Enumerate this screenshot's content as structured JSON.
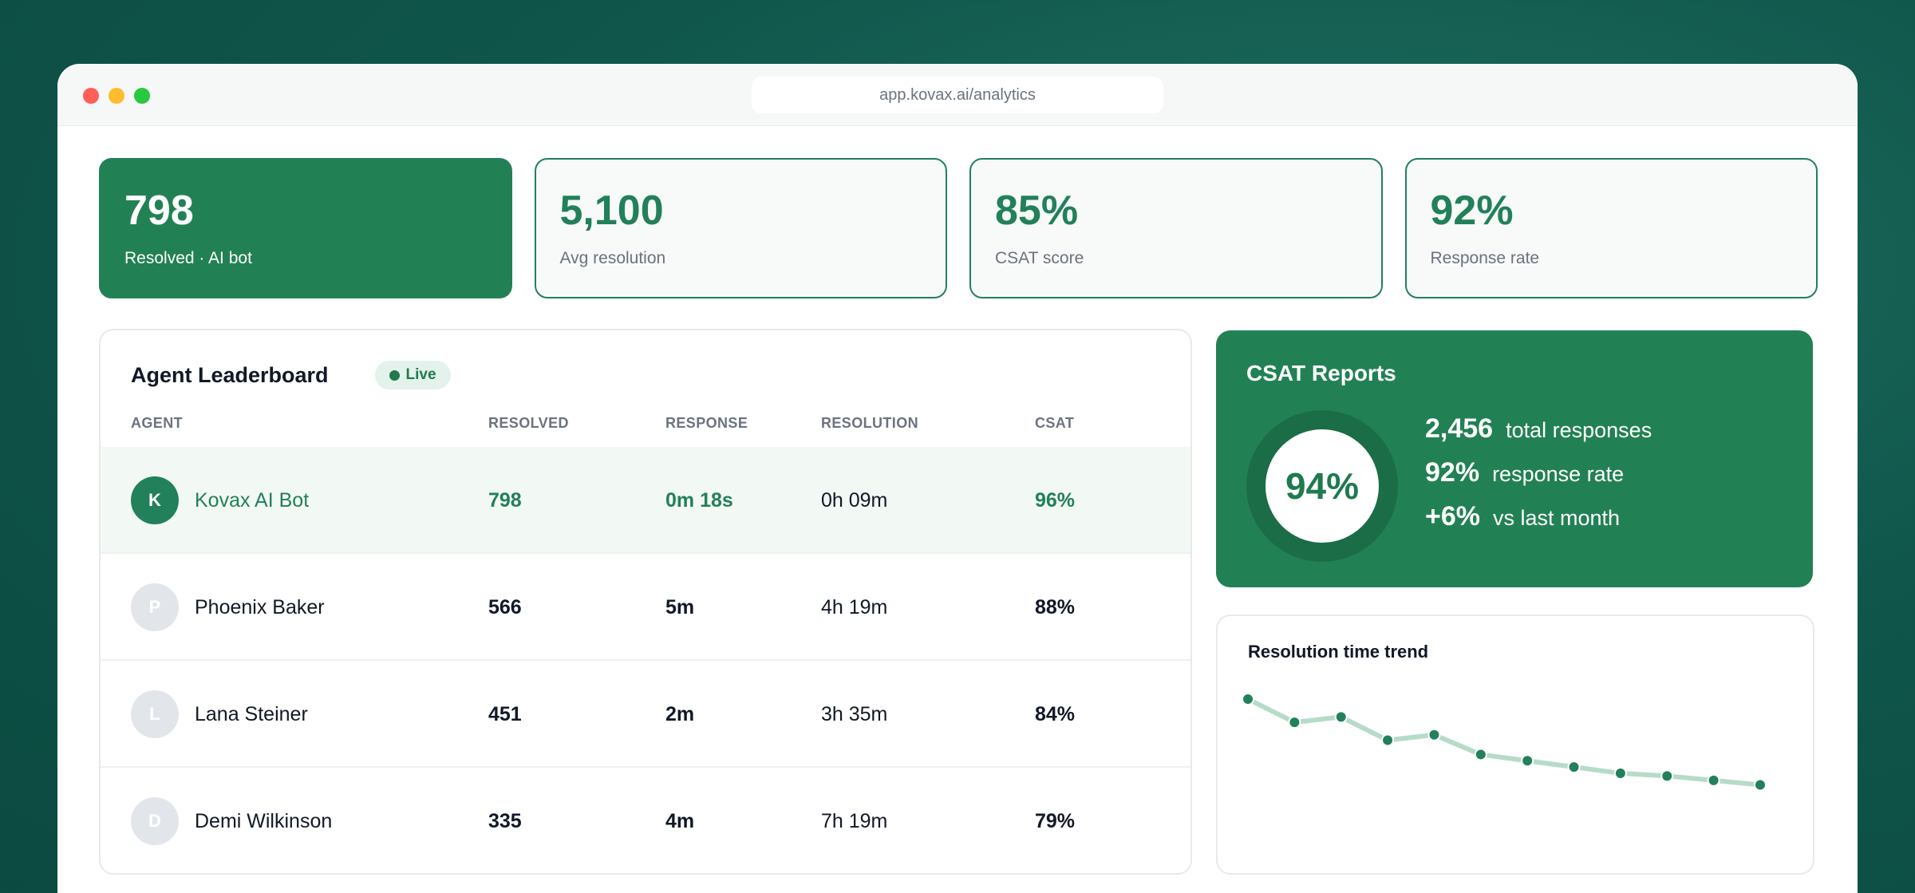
{
  "browser": {
    "url": "app.kovax.ai/analytics"
  },
  "stats": [
    {
      "value": "798",
      "label": "Resolved · AI bot",
      "active": true
    },
    {
      "value": "5,100",
      "label": "Avg resolution",
      "active": false
    },
    {
      "value": "85%",
      "label": "CSAT score",
      "active": false
    },
    {
      "value": "92%",
      "label": "Response rate",
      "active": false
    }
  ],
  "leaderboard": {
    "title": "Agent Leaderboard",
    "badge": "Live",
    "columns": [
      "AGENT",
      "RESOLVED",
      "RESPONSE",
      "RESOLUTION",
      "CSAT"
    ],
    "rows": [
      {
        "initial": "K",
        "name": "Kovax AI Bot",
        "resolved": "798",
        "response": "0m 18s",
        "resolution": "0h 09m",
        "csat": "96%"
      },
      {
        "initial": "P",
        "name": "Phoenix Baker",
        "resolved": "566",
        "response": "5m",
        "resolution": "4h 19m",
        "csat": "88%"
      },
      {
        "initial": "L",
        "name": "Lana Steiner",
        "resolved": "451",
        "response": "2m",
        "resolution": "3h 35m",
        "csat": "84%"
      },
      {
        "initial": "D",
        "name": "Demi Wilkinson",
        "resolved": "335",
        "response": "4m",
        "resolution": "7h 19m",
        "csat": "79%"
      }
    ]
  },
  "csat_report": {
    "title": "CSAT Reports",
    "score": "94%",
    "metrics": [
      {
        "value": "2,456",
        "label": "total responses"
      },
      {
        "value": "92%",
        "label": "response rate"
      },
      {
        "value": "+6%",
        "label": "vs last month"
      }
    ]
  },
  "trend": {
    "title": "Resolution time trend",
    "line_color": "#b6dcc8",
    "point_color": "#22805a"
  },
  "colors": {
    "brand": "#22805a",
    "brand_dark": "#1b6d47",
    "highlight_row": "#f2f8f4"
  },
  "chart_data": {
    "type": "line",
    "title": "Resolution time trend",
    "xlabel": "",
    "ylabel": "",
    "x": [
      1,
      2,
      3,
      4,
      5,
      6,
      7,
      8,
      9,
      10,
      11,
      12
    ],
    "values": [
      100,
      74,
      80,
      54,
      60,
      38,
      31,
      24,
      17,
      14,
      9,
      4
    ],
    "ylim": [
      0,
      100
    ],
    "grid": false,
    "legend": "none"
  }
}
